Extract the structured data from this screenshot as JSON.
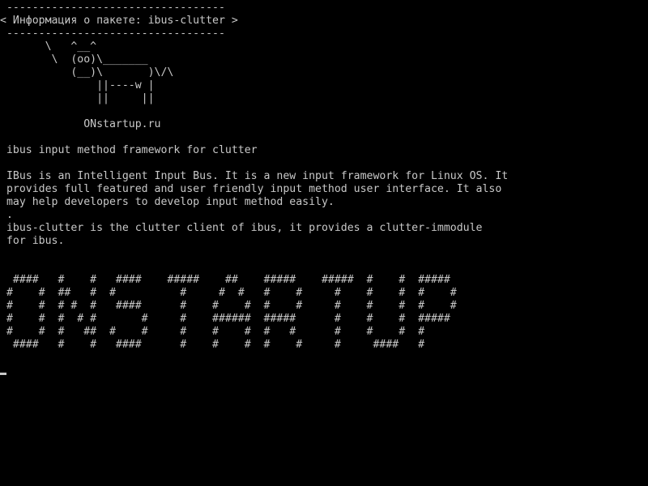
{
  "terminal": {
    "lines": [
      " ----------------------------------",
      "< Информация о пакете: ibus-clutter >",
      " ----------------------------------",
      "       \\   ^__^",
      "        \\  (oo)\\_______",
      "           (__)\\       )\\/\\",
      "               ||----w |",
      "               ||     ||",
      "",
      "             ONstartup.ru",
      "",
      " ibus input method framework for clutter",
      "",
      " IBus is an Intelligent Input Bus. It is a new input framework for Linux OS. It",
      " provides full featured and user friendly input method user interface. It also",
      " may help developers to develop input method easily.",
      " .",
      " ibus-clutter is the clutter client of ibus, it provides a clutter-immodule",
      " for ibus.",
      "",
      "",
      "  ####   #    #   ####    #####    ##    #####    #####  #    #  #####",
      " #    #  ##   #  #          #     #  #   #    #     #    #    #  #    #",
      " #    #  # #  #   ####      #    #    #  #    #     #    #    #  #    #",
      " #    #  #  # #       #     #    ######  #####      #    #    #  #####",
      " #    #  #   ##  #    #     #    #    #  #   #      #    #    #  #",
      "  ####   #    #   ####      #    #    #  #    #     #     ####   #"
    ],
    "colors": {
      "background": "#000000",
      "foreground": "#c8c8c8"
    }
  }
}
